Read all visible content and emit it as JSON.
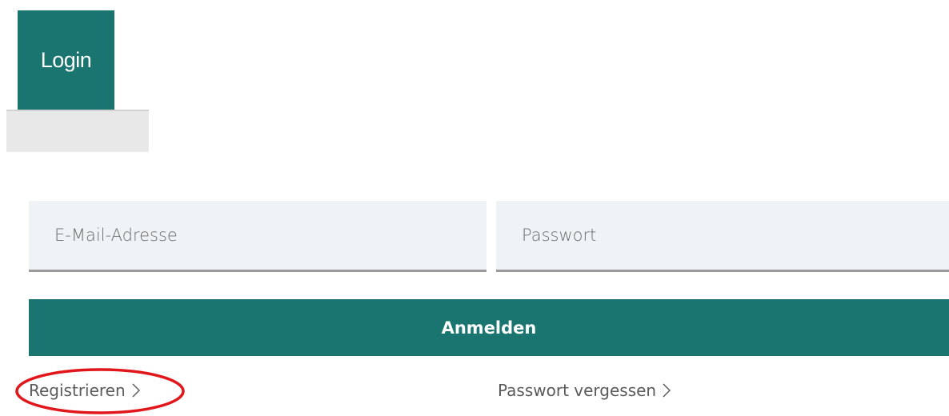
{
  "tab": {
    "label": "Login"
  },
  "form": {
    "email_placeholder": "E-Mail-Adresse",
    "password_placeholder": "Passwort",
    "submit_label": "Anmelden"
  },
  "links": {
    "register": "Registrieren",
    "forgot_password": "Passwort vergessen"
  },
  "icons": {
    "link_chevron": "chevron-right-icon"
  },
  "colors": {
    "brand": "#1a7570",
    "field_background": "#f0f3f5",
    "annotation": "#e0161b"
  }
}
